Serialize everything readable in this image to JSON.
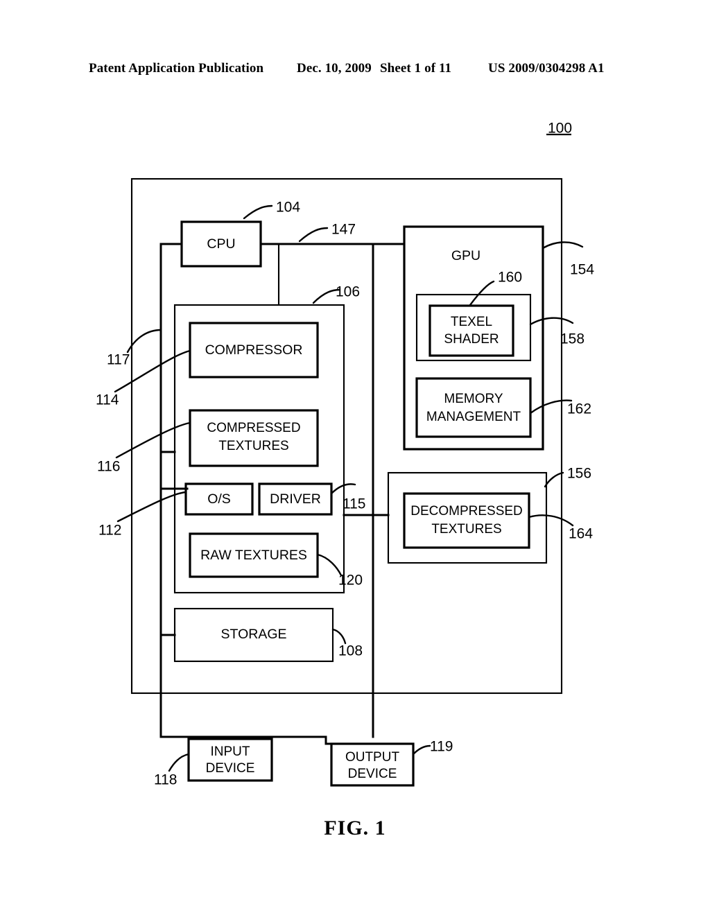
{
  "header": {
    "publication": "Patent Application Publication",
    "date": "Dec. 10, 2009",
    "sheet": "Sheet 1 of 11",
    "patent_number": "US 2009/0304298 A1"
  },
  "figure": {
    "caption": "FIG. 1",
    "system_ref": "100"
  },
  "blocks": {
    "cpu": "CPU",
    "gpu": "GPU",
    "compressor": "COMPRESSOR",
    "compressed_textures_l1": "COMPRESSED",
    "compressed_textures_l2": "TEXTURES",
    "os": "O/S",
    "driver": "DRIVER",
    "raw_textures": "RAW TEXTURES",
    "storage": "STORAGE",
    "texel_shader_l1": "TEXEL",
    "texel_shader_l2": "SHADER",
    "memory_management_l1": "MEMORY",
    "memory_management_l2": "MANAGEMENT",
    "decompressed_textures_l1": "DECOMPRESSED",
    "decompressed_textures_l2": "TEXTURES",
    "input_device_l1": "INPUT",
    "input_device_l2": "DEVICE",
    "output_device_l1": "OUTPUT",
    "output_device_l2": "DEVICE"
  },
  "refs": {
    "r104": "104",
    "r147": "147",
    "r106": "106",
    "r117": "117",
    "r114": "114",
    "r116": "116",
    "r112": "112",
    "r115": "115",
    "r120": "120",
    "r108": "108",
    "r118": "118",
    "r119": "119",
    "r154": "154",
    "r158": "158",
    "r160": "160",
    "r162": "162",
    "r156": "156",
    "r164": "164"
  }
}
